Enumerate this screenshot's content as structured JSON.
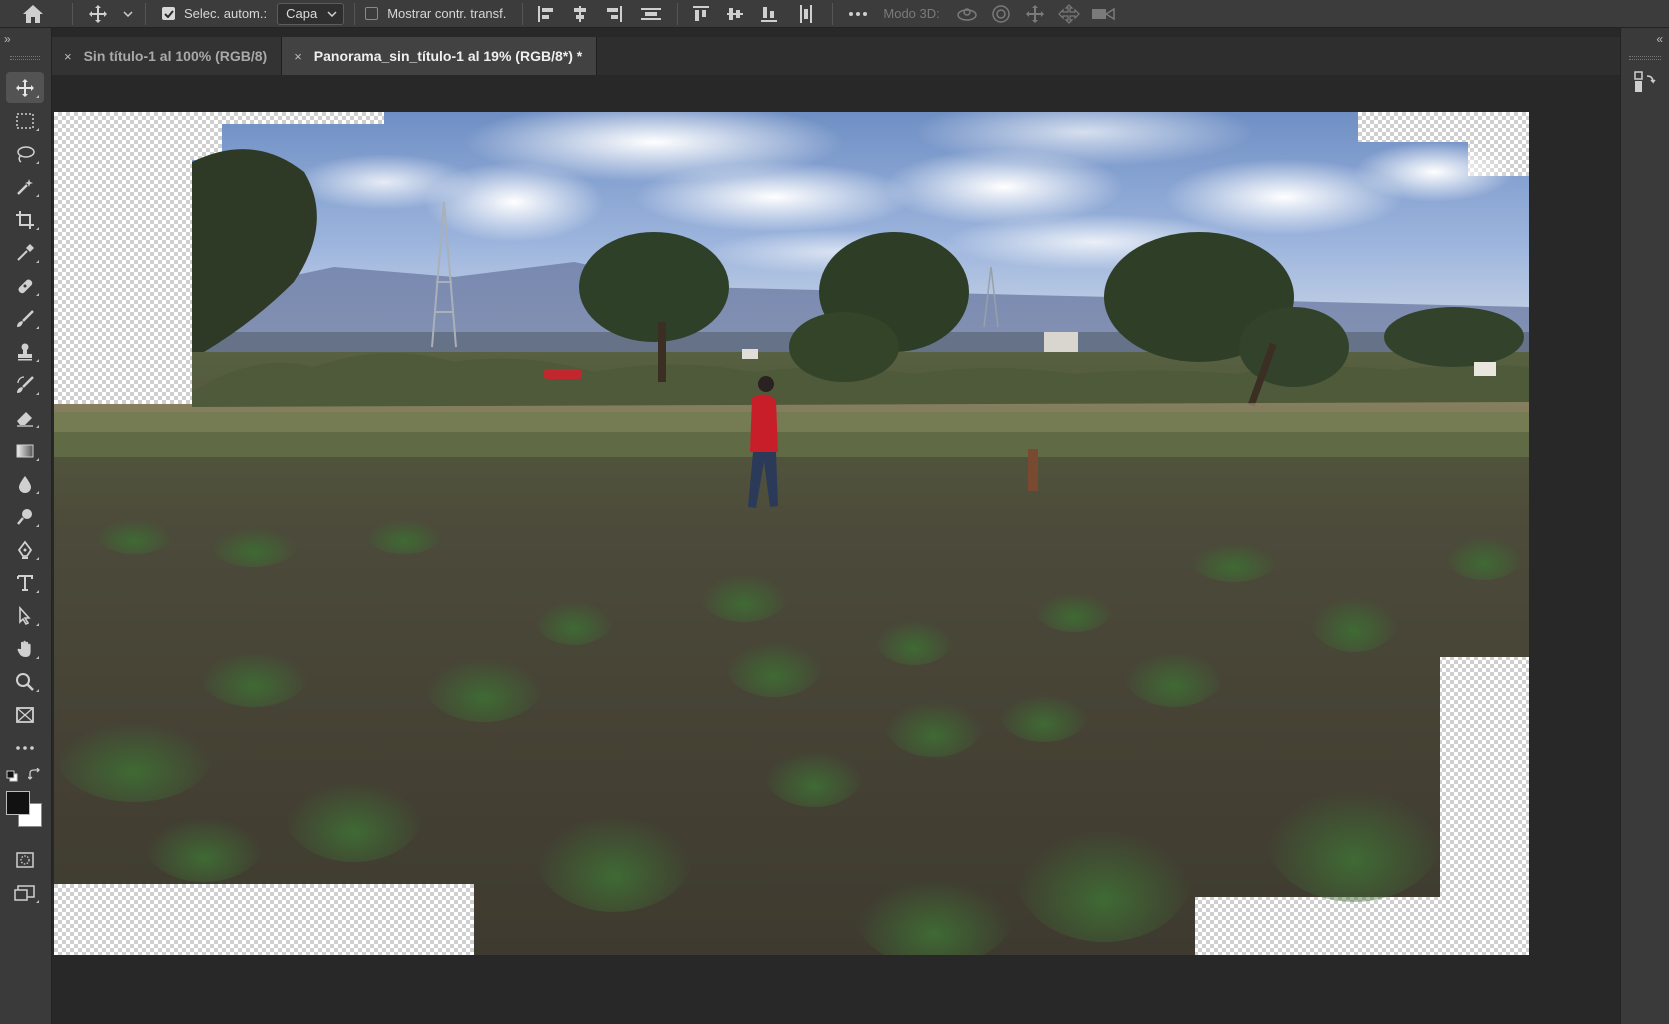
{
  "app": {
    "name": "Photoshop"
  },
  "options_bar": {
    "auto_select_label": "Selec. autom.:",
    "auto_select_checked": true,
    "layer_select_value": "Capa",
    "show_transform_label": "Mostrar contr. transf.",
    "show_transform_checked": false,
    "mode_3d_label": "Modo 3D:"
  },
  "tabs": [
    {
      "close": "×",
      "label": "Sin título-1 al 100% (RGB/8)",
      "active": false
    },
    {
      "close": "×",
      "label": "Panorama_sin_título-1 al 19% (RGB/8*) *",
      "active": true
    }
  ],
  "panel_collapse_left": "»",
  "panel_collapse_right": "«",
  "tools": [
    {
      "name": "move-tool",
      "icon": "move-icon",
      "selected": true
    },
    {
      "name": "marquee-tool",
      "icon": "marquee-icon"
    },
    {
      "name": "lasso-tool",
      "icon": "lasso-icon"
    },
    {
      "name": "magic-wand-tool",
      "icon": "magic-wand-icon"
    },
    {
      "name": "crop-tool",
      "icon": "crop-icon"
    },
    {
      "name": "eyedropper-tool",
      "icon": "eyedropper-icon"
    },
    {
      "name": "healing-brush-tool",
      "icon": "bandage-icon"
    },
    {
      "name": "brush-tool",
      "icon": "brush-icon"
    },
    {
      "name": "clone-stamp-tool",
      "icon": "stamp-icon"
    },
    {
      "name": "history-brush-tool",
      "icon": "history-brush-icon"
    },
    {
      "name": "eraser-tool",
      "icon": "eraser-icon"
    },
    {
      "name": "gradient-tool",
      "icon": "gradient-icon"
    },
    {
      "name": "blur-tool",
      "icon": "drop-icon"
    },
    {
      "name": "dodge-tool",
      "icon": "dodge-icon"
    },
    {
      "name": "pen-tool",
      "icon": "pen-icon"
    },
    {
      "name": "type-tool",
      "icon": "type-icon"
    },
    {
      "name": "path-selection-tool",
      "icon": "arrow-icon"
    },
    {
      "name": "hand-tool",
      "icon": "hand-icon"
    },
    {
      "name": "zoom-tool",
      "icon": "zoom-icon"
    },
    {
      "name": "frame-tool",
      "icon": "frame-icon"
    },
    {
      "name": "more-tools",
      "icon": "ellipsis-icon"
    }
  ],
  "colors": {
    "foreground": "#111111",
    "background": "#ffffff",
    "ui_dark": "#282828",
    "ui_panel": "#3a3a3a",
    "accent": "#4d4d4d"
  }
}
